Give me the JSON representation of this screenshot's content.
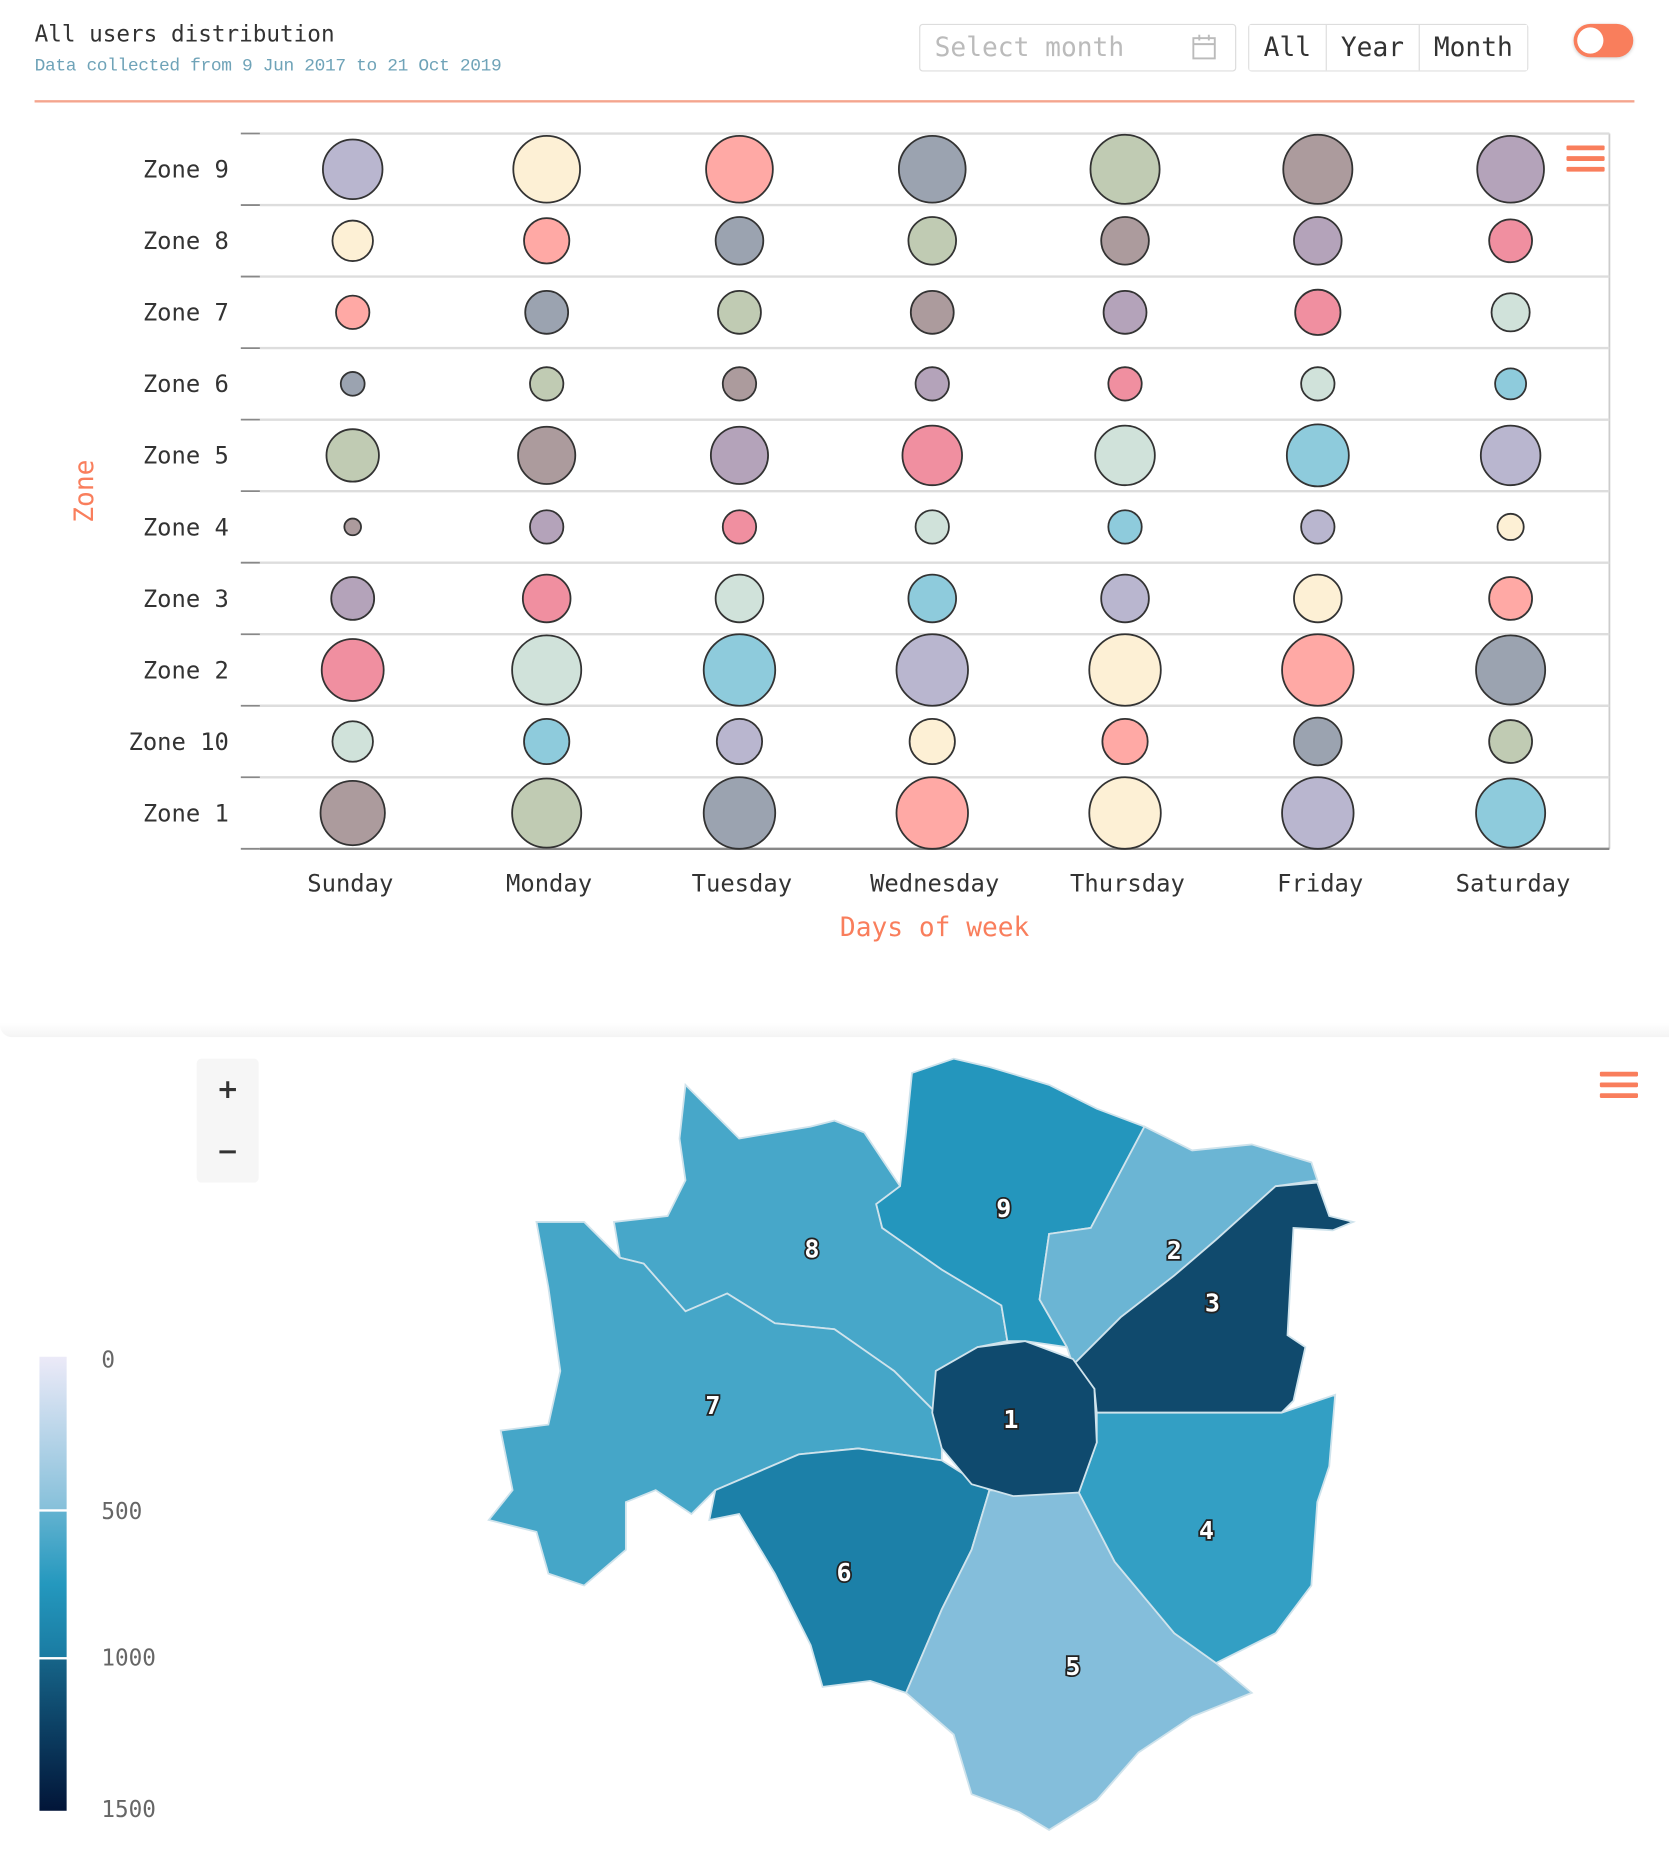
{
  "header": {
    "title": "All users distribution",
    "subtitle": "Data collected from 9 Jun 2017 to 21 Oct 2019",
    "month_placeholder": "Select month",
    "range_buttons": [
      "All",
      "Year",
      "Month"
    ],
    "toggle_on": true,
    "accent": "#f97e5c"
  },
  "chart_data": [
    {
      "type": "scatter",
      "subtype": "bubble",
      "xlabel": "Days of week",
      "ylabel": "Zone",
      "categories": [
        "Sunday",
        "Monday",
        "Tuesday",
        "Wednesday",
        "Thursday",
        "Friday",
        "Saturday"
      ],
      "zones": [
        "Zone 9",
        "Zone 8",
        "Zone 7",
        "Zone 6",
        "Zone 5",
        "Zone 4",
        "Zone 3",
        "Zone 2",
        "Zone 10",
        "Zone 1"
      ],
      "relative_bubble_size": [
        [
          25,
          28,
          28,
          28,
          29,
          29,
          28
        ],
        [
          17,
          19,
          20,
          20,
          20,
          20,
          18
        ],
        [
          14,
          18,
          18,
          18,
          18,
          19,
          16
        ],
        [
          10,
          14,
          14,
          14,
          14,
          14,
          13
        ],
        [
          22,
          24,
          24,
          25,
          25,
          26,
          25
        ],
        [
          7,
          14,
          14,
          14,
          14,
          14,
          11
        ],
        [
          18,
          20,
          20,
          20,
          20,
          20,
          18
        ],
        [
          26,
          29,
          30,
          30,
          30,
          30,
          29
        ],
        [
          17,
          19,
          19,
          19,
          19,
          20,
          18
        ],
        [
          27,
          29,
          30,
          30,
          30,
          30,
          29
        ]
      ],
      "colors": [
        [
          "#b9b6cf",
          "#fdf0d5",
          "#ffa9a5",
          "#9ba3b0",
          "#c0cbb3",
          "#ac9b9d",
          "#b4a3ba"
        ],
        [
          "#fdf0d5",
          "#ffa9a5",
          "#9ba3b0",
          "#c0cbb3",
          "#ac9b9d",
          "#b4a3ba",
          "#f08fa0"
        ],
        [
          "#ffa9a5",
          "#9ba3b0",
          "#c0cbb3",
          "#ac9b9d",
          "#b4a3ba",
          "#f08fa0",
          "#d0e2da"
        ],
        [
          "#9ba3b0",
          "#c0cbb3",
          "#ac9b9d",
          "#b4a3ba",
          "#f08fa0",
          "#d0e2da",
          "#8ecbdc"
        ],
        [
          "#c0cbb3",
          "#ac9b9d",
          "#b4a3ba",
          "#f08fa0",
          "#d0e2da",
          "#8ecbdc",
          "#b9b6cf"
        ],
        [
          "#ac9b9d",
          "#b4a3ba",
          "#f08fa0",
          "#d0e2da",
          "#8ecbdc",
          "#b9b6cf",
          "#fdf0d5"
        ],
        [
          "#b4a3ba",
          "#f08fa0",
          "#d0e2da",
          "#8ecbdc",
          "#b9b6cf",
          "#fdf0d5",
          "#ffa9a5"
        ],
        [
          "#f08fa0",
          "#d0e2da",
          "#8ecbdc",
          "#b9b6cf",
          "#fdf0d5",
          "#ffa9a5",
          "#9ba3b0"
        ],
        [
          "#d0e2da",
          "#8ecbdc",
          "#b9b6cf",
          "#fdf0d5",
          "#ffa9a5",
          "#9ba3b0",
          "#c0cbb3"
        ],
        [
          "#ac9b9d",
          "#c0cbb3",
          "#9ba3b0",
          "#ffa9a5",
          "#fdf0d5",
          "#b9b6cf",
          "#8ecbdc"
        ]
      ],
      "grid": true
    },
    {
      "type": "choropleth",
      "regions": [
        {
          "label": "1",
          "value": 1300,
          "color": "#0f4a6e"
        },
        {
          "label": "2",
          "value": 500,
          "color": "#6bb5d4"
        },
        {
          "label": "3",
          "value": 1300,
          "color": "#104a6d"
        },
        {
          "label": "4",
          "value": 750,
          "color": "#339fc4"
        },
        {
          "label": "5",
          "value": 400,
          "color": "#84bedb"
        },
        {
          "label": "6",
          "value": 950,
          "color": "#1c80a8"
        },
        {
          "label": "7",
          "value": 650,
          "color": "#45a6c8"
        },
        {
          "label": "8",
          "value": 650,
          "color": "#47a7c9"
        },
        {
          "label": "9",
          "value": 800,
          "color": "#2496bd"
        }
      ],
      "colorbar": {
        "ticks": [
          "0",
          "500",
          "1000",
          "1500"
        ],
        "range": [
          0,
          1500
        ]
      }
    }
  ],
  "map_controls": {
    "zoom_in": "+",
    "zoom_out": "−"
  },
  "icons": {
    "calendar": "calendar-icon",
    "menu": "hamburger-menu-icon"
  }
}
